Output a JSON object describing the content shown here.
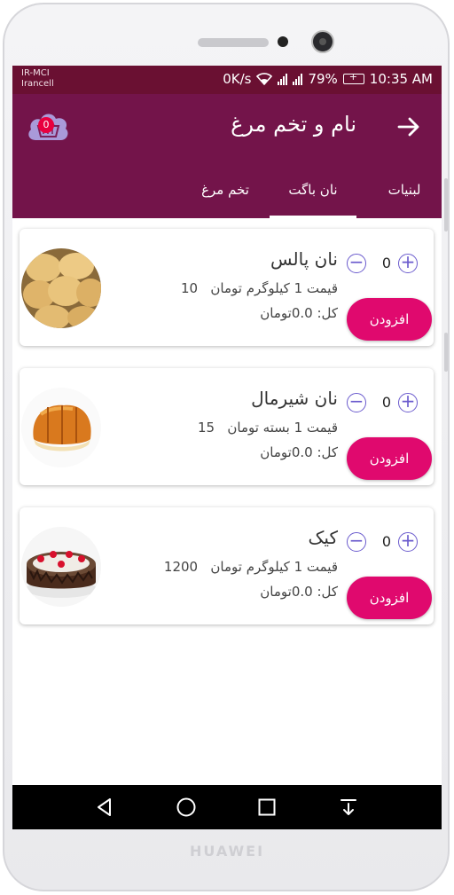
{
  "device": {
    "brand": "HUAWEI"
  },
  "statusbar": {
    "carrier_line1": "IR-MCI",
    "carrier_line2": "Irancell",
    "speed": "0K/s",
    "battery": "79%",
    "time": "10:35 AM"
  },
  "appbar": {
    "title": "نام و تخم مرغ",
    "cart_count": "0"
  },
  "tabs": [
    {
      "label": "لبنیات",
      "selected": false
    },
    {
      "label": "نان باگت",
      "selected": true
    },
    {
      "label": "تخم مرغ",
      "selected": false
    }
  ],
  "products": [
    {
      "name": "نان پالس",
      "price_label": "قیمت 1 کیلوگرم تومان",
      "price": "10",
      "total": "کل: 0.0تومان",
      "qty": "0",
      "add_label": "افزودن"
    },
    {
      "name": "نان شیرمال",
      "price_label": "قیمت 1 بسته تومان",
      "price": "15",
      "total": "کل: 0.0تومان",
      "qty": "0",
      "add_label": "افزودن"
    },
    {
      "name": "کیک",
      "price_label": "قیمت 1 کیلوگرم تومان",
      "price": "1200",
      "total": "کل: 0.0تومان",
      "qty": "0",
      "add_label": "افزودن"
    }
  ],
  "colors": {
    "statusbar": "#6a1032",
    "appbar": "#73144a",
    "accent": "#e0096e",
    "stepper": "#6a5acd",
    "badge": "#e8003f"
  },
  "icons": {
    "back": "arrow-right-icon",
    "cart": "basket-cloud-icon",
    "nav": [
      "back-triangle-icon",
      "home-circle-icon",
      "recents-square-icon",
      "notification-pull-icon"
    ]
  }
}
